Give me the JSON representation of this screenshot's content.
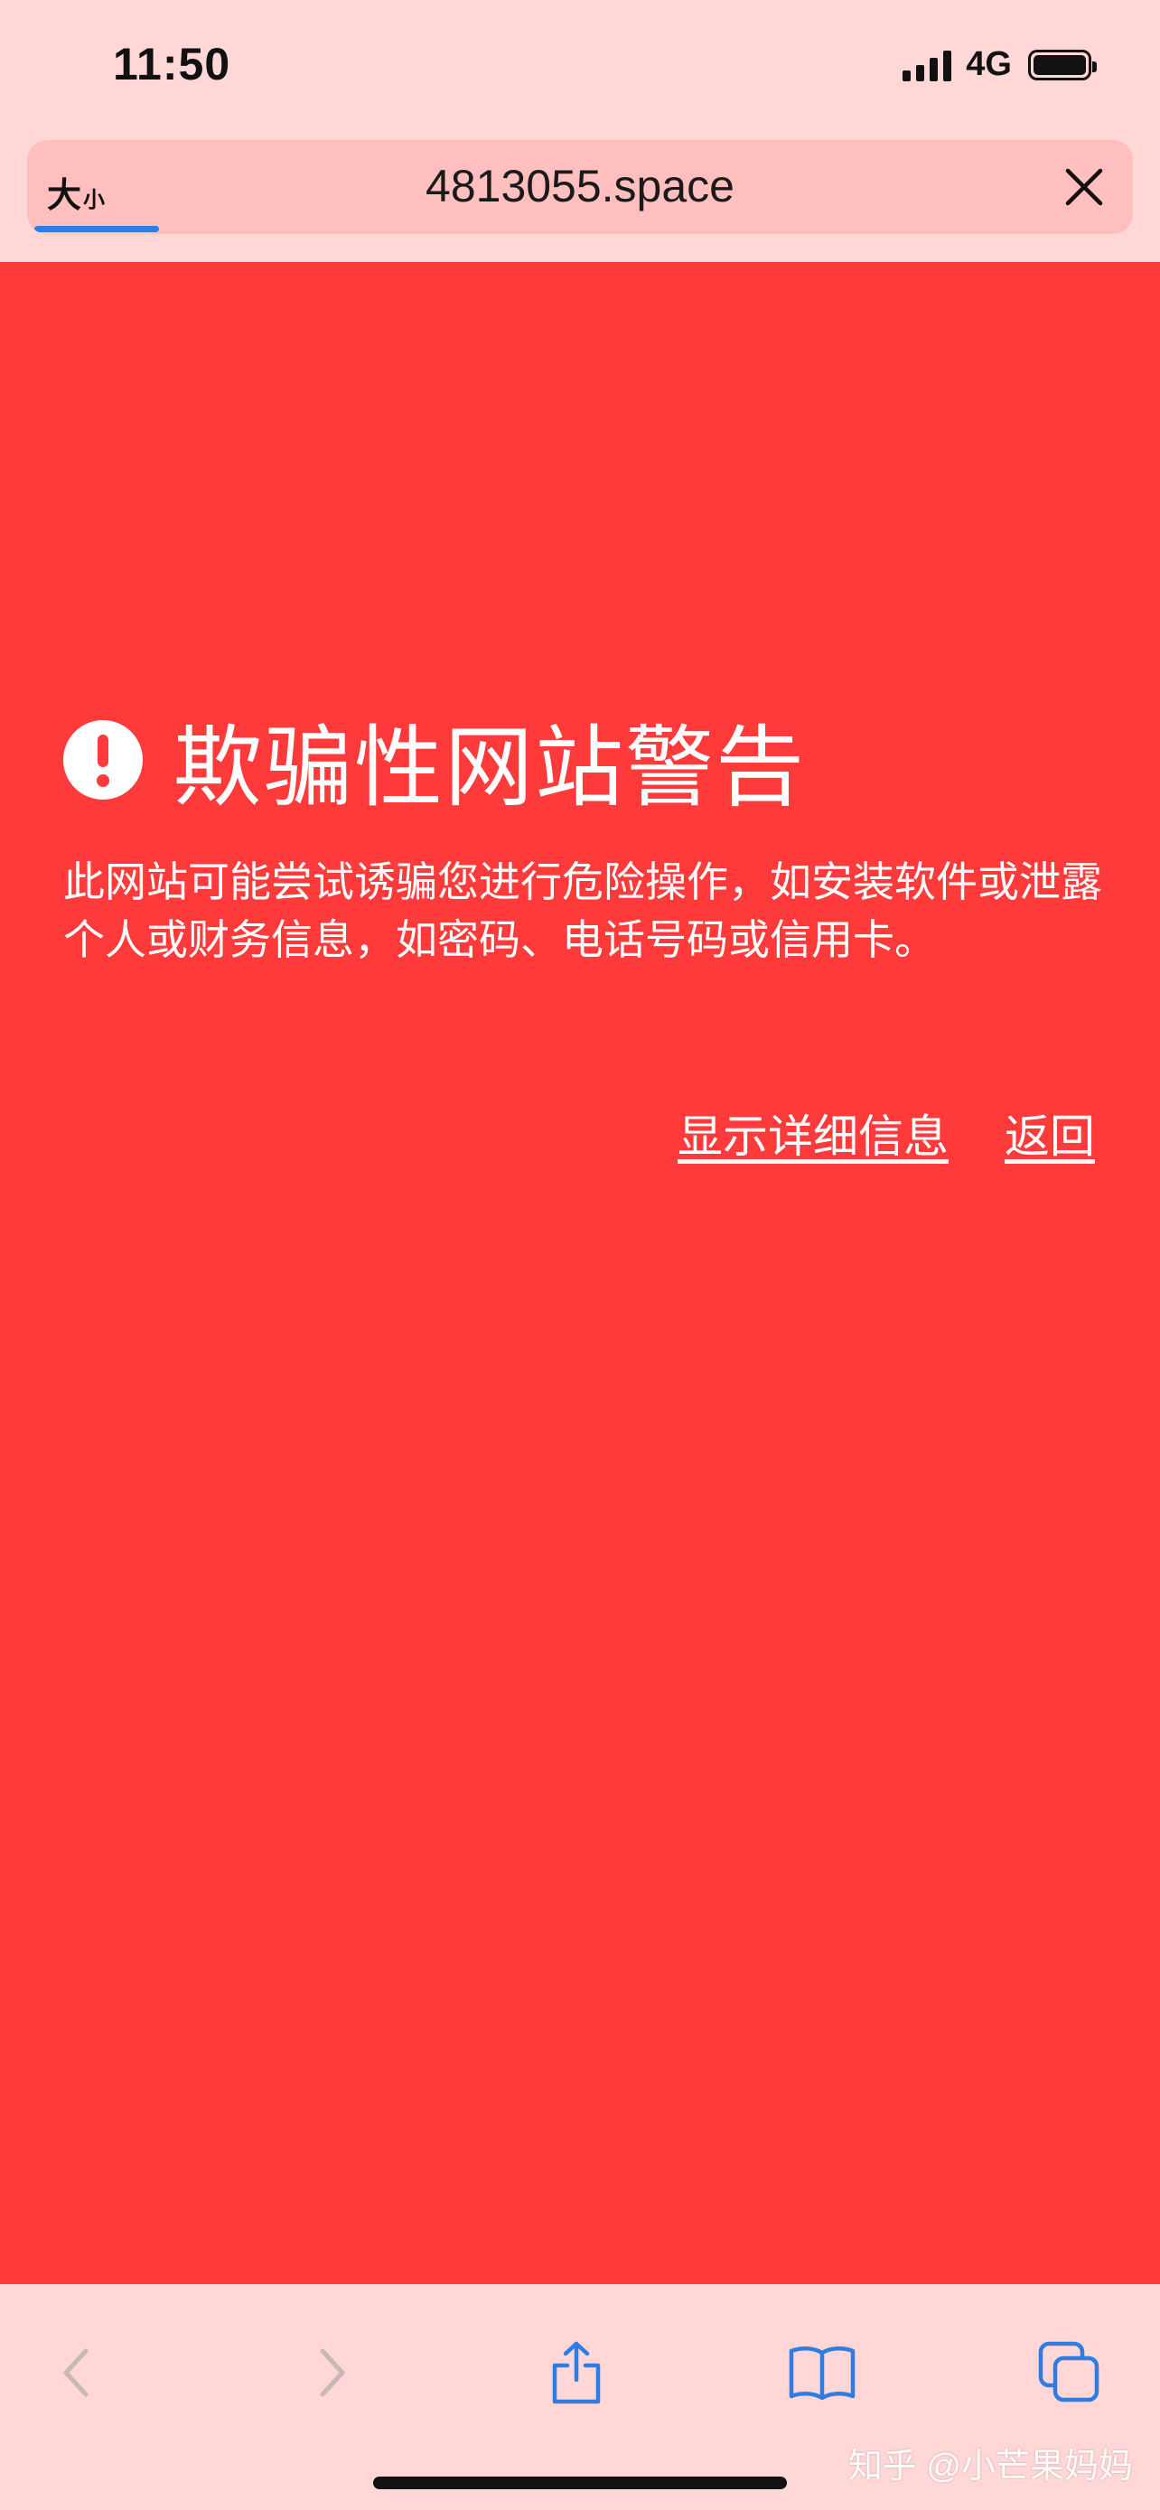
{
  "status_bar": {
    "time": "11:50",
    "network": "4G"
  },
  "address_bar": {
    "text_size_large": "大",
    "text_size_small": "小",
    "url": "4813055.space"
  },
  "warning": {
    "title": "欺骗性网站警告",
    "message": "此网站可能尝试诱骗您进行危险操作，如安装软件或泄露个人或财务信息，如密码、电话号码或信用卡。",
    "show_details_label": "显示详细信息",
    "back_label": "返回",
    "background_color": "#fe3b3a"
  },
  "toolbar": {
    "icons": [
      "back-icon",
      "forward-icon",
      "share-icon",
      "bookmarks-icon",
      "tabs-icon"
    ],
    "accent_color": "#2f7de1"
  },
  "watermark": "知乎 @小芒果妈妈"
}
